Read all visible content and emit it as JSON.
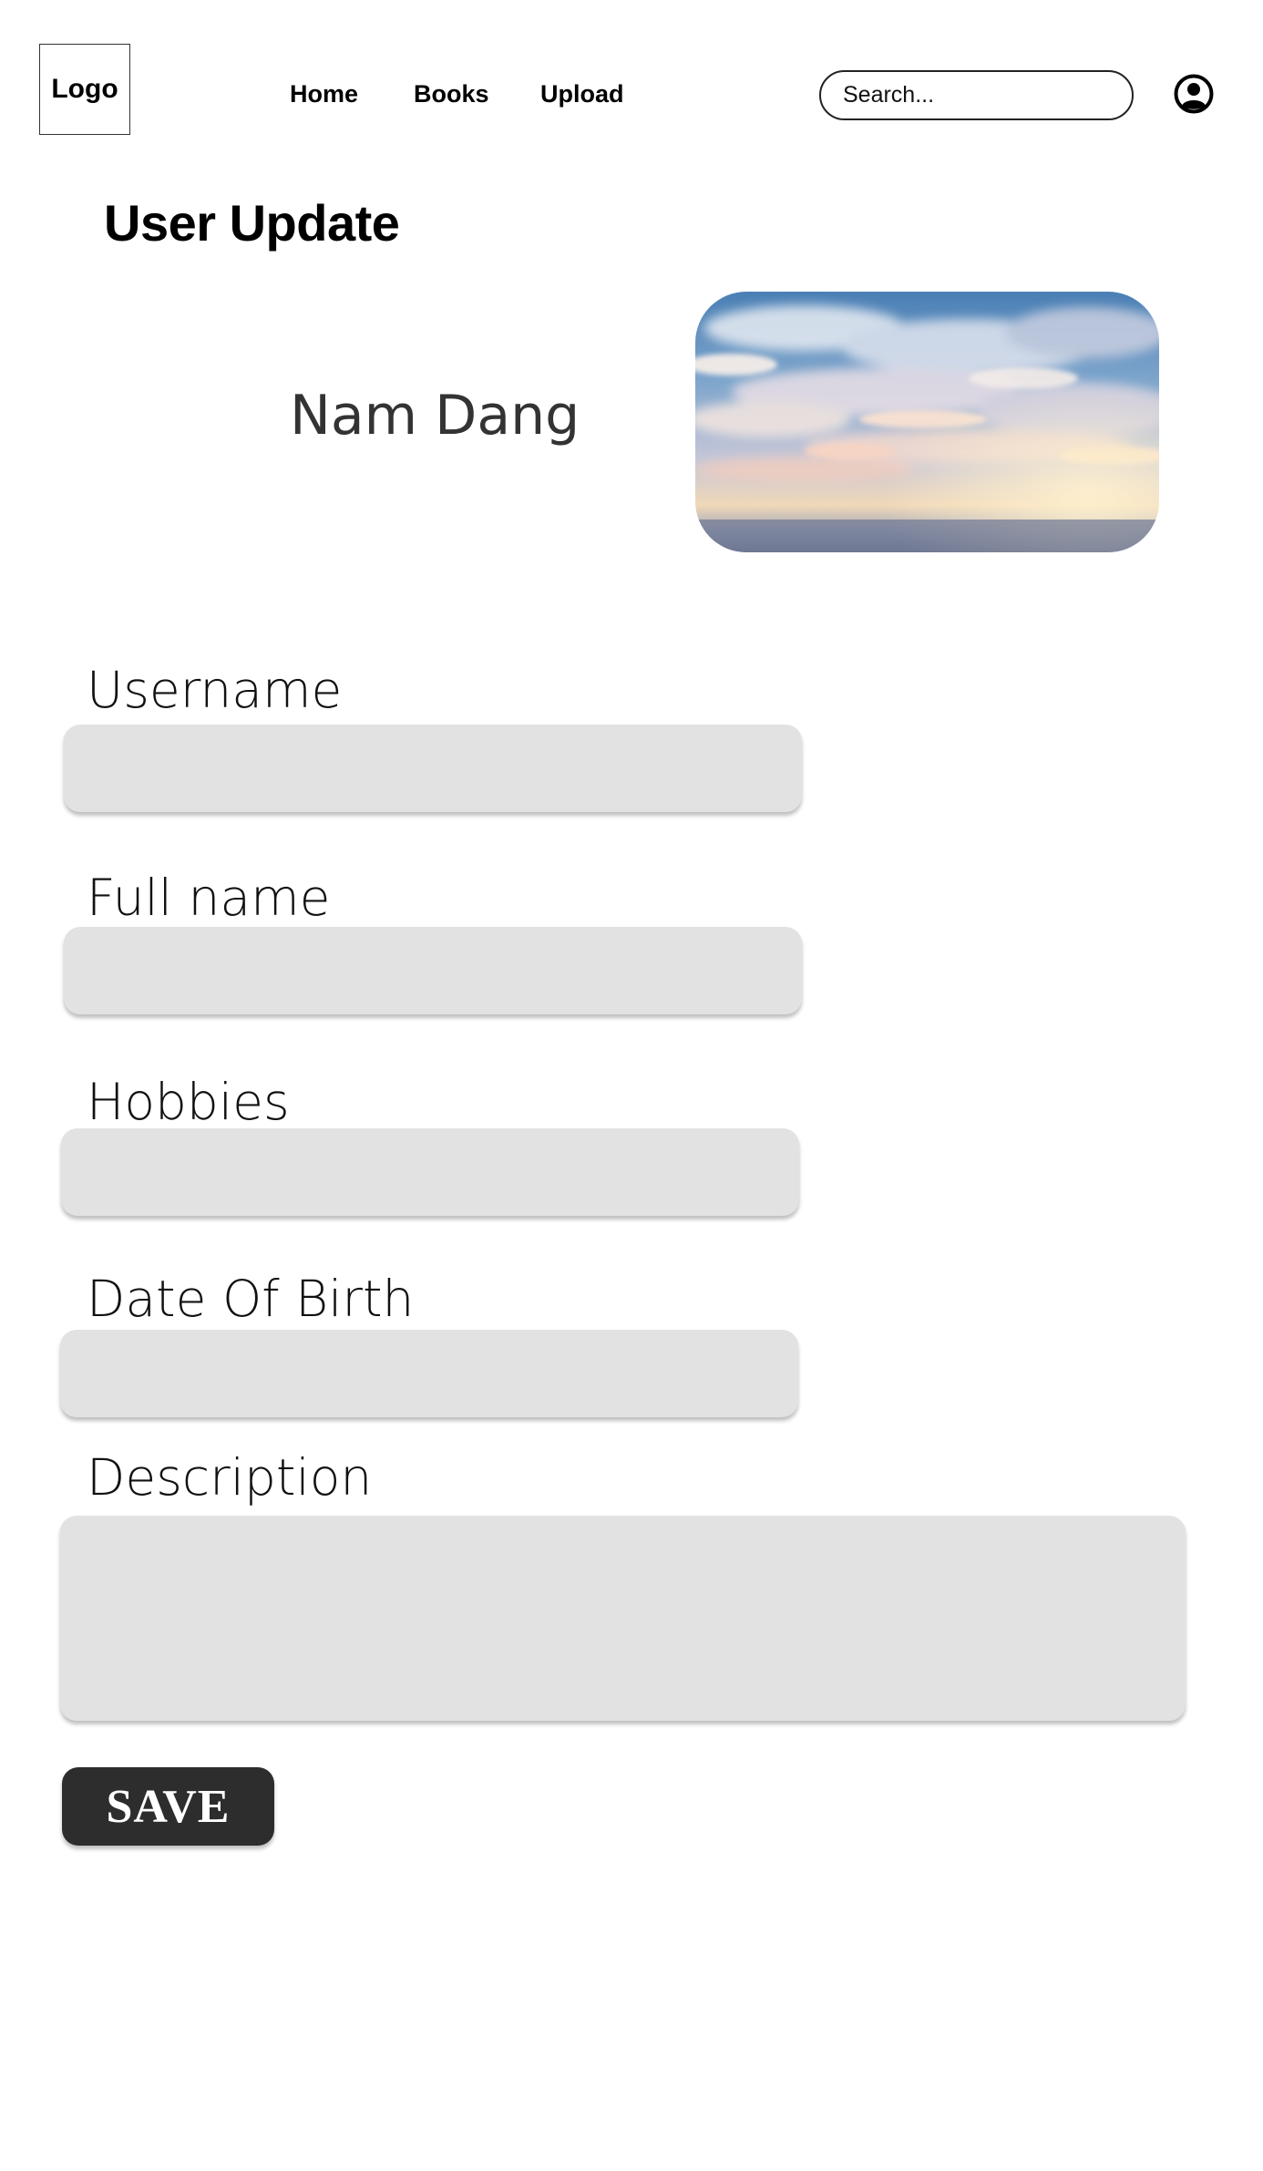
{
  "header": {
    "logo_text": "Logo",
    "nav": {
      "home": "Home",
      "books": "Books",
      "upload": "Upload"
    },
    "search": {
      "placeholder": "Search...",
      "icon": "search-icon"
    },
    "profile_icon": "user-circle-icon"
  },
  "main": {
    "title": "User Update",
    "user_name": "Nam Dang",
    "cover_image": "sky-clouds-photo"
  },
  "form": {
    "username": {
      "label": "Username",
      "value": ""
    },
    "full_name": {
      "label": "Full name",
      "value": ""
    },
    "hobbies": {
      "label": "Hobbies",
      "value": ""
    },
    "date_of_birth": {
      "label": "Date Of Birth",
      "value": ""
    },
    "description": {
      "label": "Description",
      "value": ""
    },
    "save_label": "SAVE"
  },
  "colors": {
    "input_background": "#e2e2e2",
    "button_background": "#2d2d2d",
    "button_text": "#ffffff"
  }
}
